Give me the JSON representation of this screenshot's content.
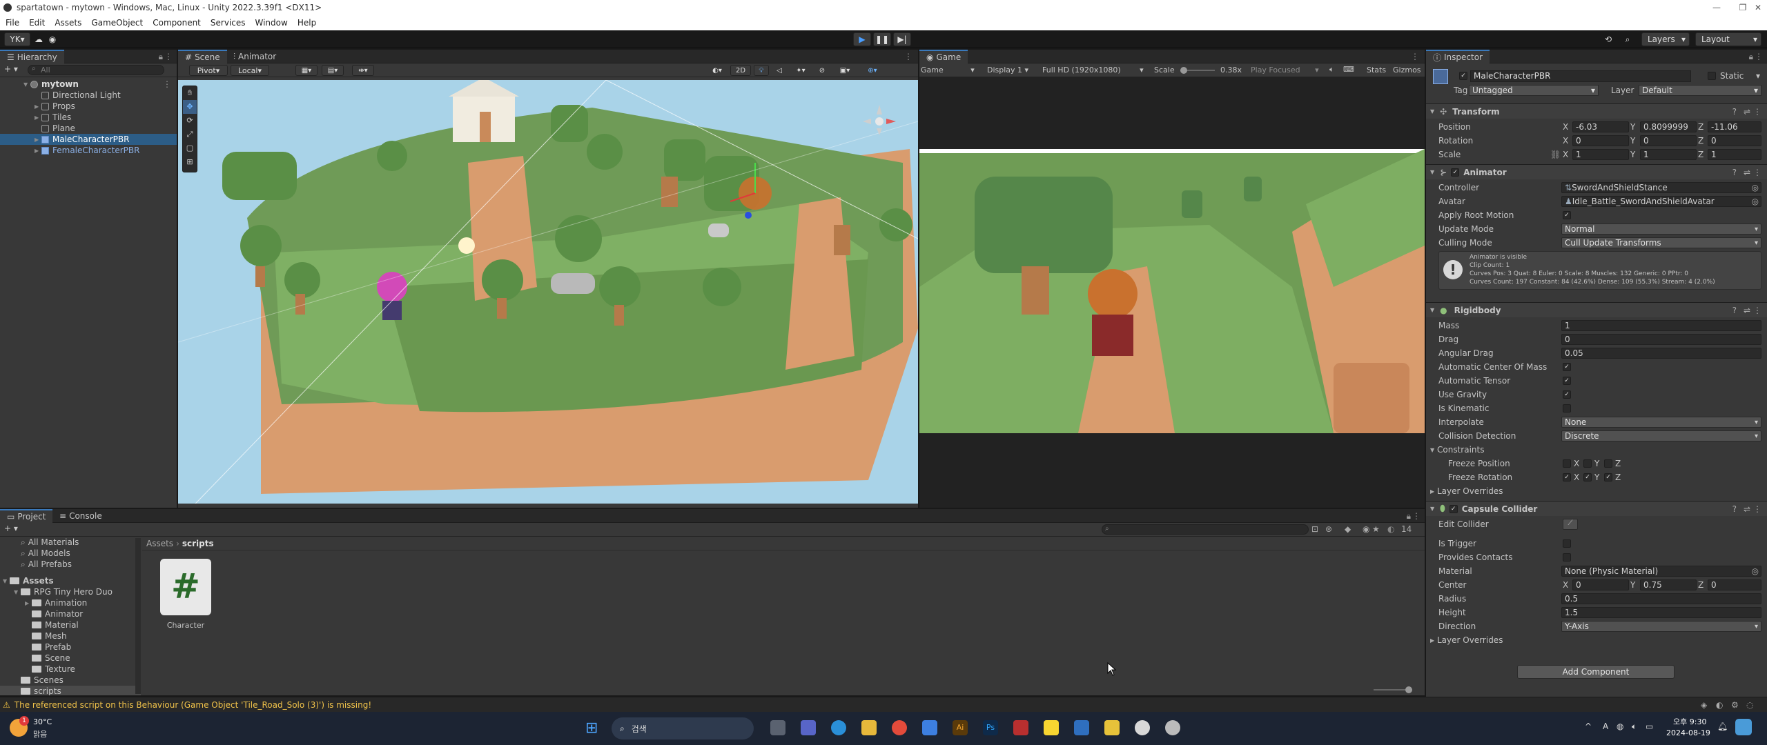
{
  "window": {
    "title": "spartatown - mytown - Windows, Mac, Linux - Unity 2022.3.39f1 <DX11>"
  },
  "menu": [
    "File",
    "Edit",
    "Assets",
    "GameObject",
    "Component",
    "Services",
    "Window",
    "Help"
  ],
  "toolbar": {
    "account": "YK",
    "layers": "Layers",
    "layout": "Layout"
  },
  "hierarchy": {
    "tab": "Hierarchy",
    "search_placeholder": "All",
    "scene": "mytown",
    "items": [
      "Directional Light",
      "Props",
      "Tiles",
      "Plane",
      "MaleCharacterPBR",
      "FemaleCharacterPBR"
    ]
  },
  "scene_view": {
    "tabs": [
      "Scene",
      "Animator"
    ],
    "pivot": "Pivot",
    "local": "Local",
    "mode_2d": "2D"
  },
  "game_view": {
    "tab": "Game",
    "mode": "Game",
    "display": "Display 1",
    "resolution": "Full HD (1920x1080)",
    "scale_label": "Scale",
    "scale_value": "0.38x",
    "play_focused": "Play Focused",
    "stats": "Stats",
    "gizmos": "Gizmos"
  },
  "inspector": {
    "tab": "Inspector",
    "object_name": "MaleCharacterPBR",
    "static_label": "Static",
    "tag_label": "Tag",
    "tag_value": "Untagged",
    "layer_label": "Layer",
    "layer_value": "Default",
    "transform": {
      "title": "Transform",
      "position_label": "Position",
      "pos_x": "-6.03",
      "pos_y": "0.8099999",
      "pos_z": "-11.06",
      "rotation_label": "Rotation",
      "rot_x": "0",
      "rot_y": "0",
      "rot_z": "0",
      "scale_label": "Scale",
      "scale_x": "1",
      "scale_y": "1",
      "scale_z": "1"
    },
    "animator": {
      "title": "Animator",
      "controller_label": "Controller",
      "controller_value": "SwordAndShieldStance",
      "avatar_label": "Avatar",
      "avatar_value": "Idle_Battle_SwordAndShieldAvatar",
      "root_motion_label": "Apply Root Motion",
      "update_mode_label": "Update Mode",
      "update_mode_value": "Normal",
      "culling_label": "Culling Mode",
      "culling_value": "Cull Update Transforms",
      "info_line1": "Animator is visible",
      "info_line2": "Clip Count: 1",
      "info_line3": "Curves Pos: 3 Quat: 8 Euler: 0 Scale: 8 Muscles: 132 Generic: 0 PPtr: 0",
      "info_line4": "Curves Count: 197 Constant: 84 (42.6%) Dense: 109 (55.3%) Stream: 4 (2.0%)"
    },
    "rigidbody": {
      "title": "Rigidbody",
      "mass_label": "Mass",
      "mass_value": "1",
      "drag_label": "Drag",
      "drag_value": "0",
      "angular_label": "Angular Drag",
      "angular_value": "0.05",
      "acm_label": "Automatic Center Of Mass",
      "tensor_label": "Automatic Tensor",
      "gravity_label": "Use Gravity",
      "kinematic_label": "Is Kinematic",
      "interpolate_label": "Interpolate",
      "interpolate_value": "None",
      "collision_label": "Collision Detection",
      "collision_value": "Discrete",
      "constraints_label": "Constraints",
      "freeze_pos_label": "Freeze Position",
      "freeze_rot_label": "Freeze Rotation",
      "layer_overrides": "Layer Overrides"
    },
    "capsule": {
      "title": "Capsule Collider",
      "edit_label": "Edit Collider",
      "trigger_label": "Is Trigger",
      "contacts_label": "Provides Contacts",
      "material_label": "Material",
      "material_value": "None (Physic Material)",
      "center_label": "Center",
      "center_x": "0",
      "center_y": "0.75",
      "center_z": "0",
      "radius_label": "Radius",
      "radius_value": "0.5",
      "height_label": "Height",
      "height_value": "1.5",
      "direction_label": "Direction",
      "direction_value": "Y-Axis",
      "layer_overrides": "Layer Overrides"
    },
    "add_component": "Add Component"
  },
  "project": {
    "tabs": [
      "Project",
      "Console"
    ],
    "favorites": [
      "All Materials",
      "All Models",
      "All Prefabs"
    ],
    "assets_root": "Assets",
    "tree": [
      "RPG Tiny Hero Duo",
      "Animation",
      "Animator",
      "Material",
      "Mesh",
      "Prefab",
      "Scene",
      "Texture",
      "Scenes",
      "scripts"
    ],
    "breadcrumb_root": "Assets",
    "breadcrumb_leaf": "scripts",
    "file_name": "Character",
    "count": "14"
  },
  "status_message": "The referenced script on this Behaviour (Game Object 'Tile_Road_Solo (3)') is missing!",
  "taskbar": {
    "temperature": "30°C",
    "weather": "맑음",
    "search": "검색",
    "time": "오후 9:30",
    "date": "2024-08-19",
    "ime": "A"
  },
  "colors": {
    "accent": "#3a79bb",
    "selection": "#2c5d87",
    "sky": "#a9d3e8"
  }
}
